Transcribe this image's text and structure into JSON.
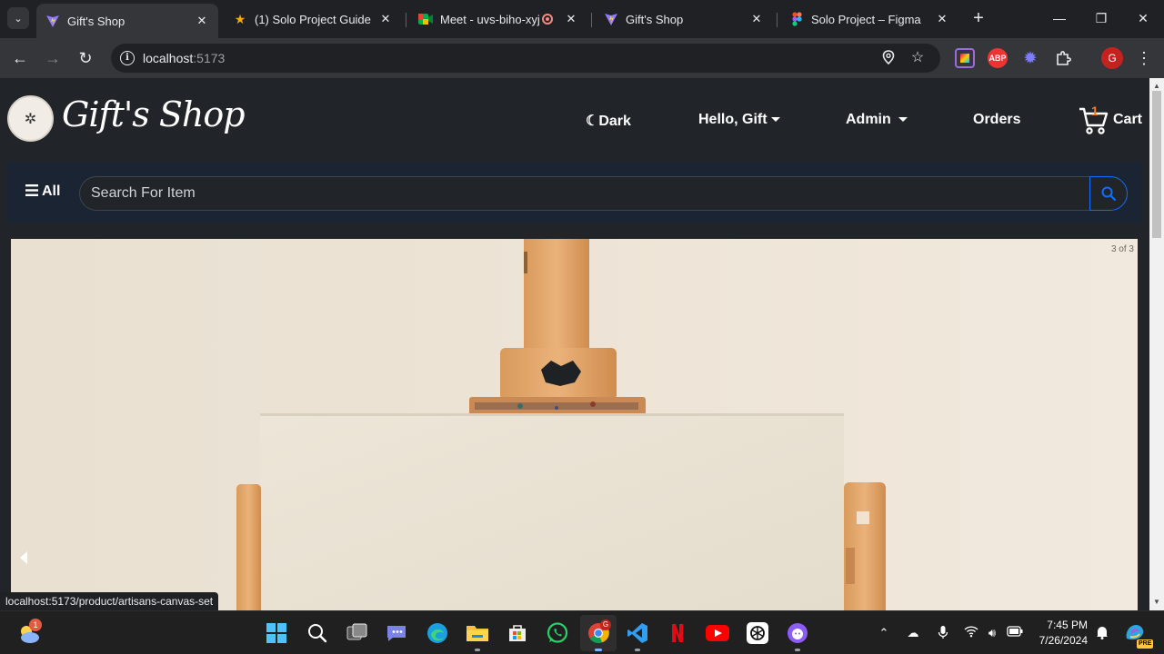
{
  "browser": {
    "tabs": [
      {
        "title": "Gift's Shop",
        "favicon": "vite-icon",
        "active": true
      },
      {
        "title": "(1) Solo Project Guide",
        "favicon": "star-icon",
        "active": false
      },
      {
        "title": "Meet - uvs-biho-xyj",
        "favicon": "meet-icon",
        "active": false,
        "recording": true
      },
      {
        "title": "Gift's Shop",
        "favicon": "vite-icon",
        "active": false
      },
      {
        "title": "Solo Project – Figma",
        "favicon": "figma-icon",
        "active": false
      }
    ],
    "new_tab_label": "+",
    "window_controls": {
      "minimize": "—",
      "restore": "❐",
      "close": "✕"
    },
    "address": {
      "host": "localhost",
      "port": ":5173"
    },
    "profile_initial": "G",
    "extensions": [
      "colorful-ext-icon",
      "adblock-icon",
      "gear-ext-icon",
      "puzzle-icon"
    ],
    "adblock_label": "ABP",
    "status_url": "localhost:5173/product/artisans-canvas-set"
  },
  "site": {
    "brand": "Gift's Shop",
    "theme_toggle": "Dark",
    "greeting": "Hello, Gift",
    "admin": "Admin",
    "orders": "Orders",
    "cart_count": "1",
    "cart_label": "Cart",
    "all_label": "All",
    "search_placeholder": "Search For Item",
    "carousel_counter": "3 of 3"
  },
  "taskbar": {
    "weather_badge": "1",
    "chrome_badge": "G",
    "time": "7:45 PM",
    "date": "7/26/2024",
    "copilot_label": "PRE"
  },
  "colors": {
    "navbar_bg": "#212529",
    "search_band_bg": "#1b2433",
    "accent_blue": "#0d6efd",
    "cart_badge": "#fd7e14",
    "chrome_bg": "#35363a"
  }
}
